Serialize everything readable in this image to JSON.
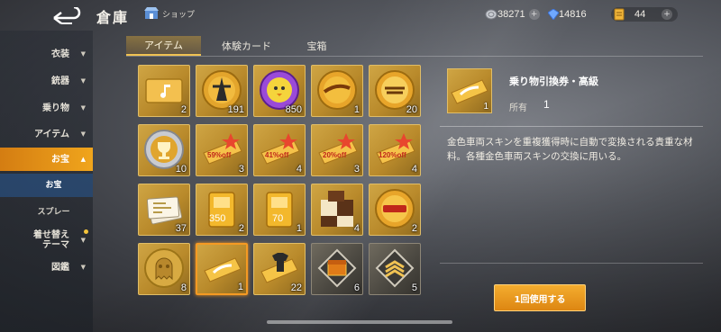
{
  "header": {
    "title": "倉庫",
    "shop_label": "ショップ",
    "currencies": [
      {
        "icon": "silver-coin-icon",
        "value": "38271"
      },
      {
        "icon": "blue-gem-icon",
        "value": "14816"
      },
      {
        "icon": "gold-ticket-icon",
        "value": "44"
      }
    ],
    "plus": "+"
  },
  "sidebar": {
    "items": [
      {
        "label": "衣装",
        "caret": "▼"
      },
      {
        "label": "銃器",
        "caret": "▼"
      },
      {
        "label": "乗り物",
        "caret": "▼"
      },
      {
        "label": "アイテム",
        "caret": "▼"
      },
      {
        "label": "お宝",
        "caret": "▲"
      },
      {
        "label": "お宝"
      },
      {
        "label": "スプレー"
      },
      {
        "label": "着せ替え\nテーマ",
        "caret": "▼"
      },
      {
        "label": "図鑑",
        "caret": "▼"
      }
    ]
  },
  "tabs": [
    {
      "label": "アイテム"
    },
    {
      "label": "体験カード"
    },
    {
      "label": "宝箱"
    }
  ],
  "items": [
    {
      "icon": "music-ticket-icon",
      "count": "2"
    },
    {
      "icon": "emblem-coin-icon",
      "count": "191"
    },
    {
      "icon": "chick-medal-icon",
      "count": "850"
    },
    {
      "icon": "event-coin-icon",
      "count": "1"
    },
    {
      "icon": "festival-coin-icon",
      "count": "20"
    },
    {
      "icon": "trophy-coin-icon",
      "count": "10"
    },
    {
      "icon": "discount-coupon-icon",
      "count": "3",
      "badge": "59%off"
    },
    {
      "icon": "discount-coupon-icon",
      "count": "4",
      "badge": "41%off"
    },
    {
      "icon": "discount-coupon-icon",
      "count": "3",
      "badge": "20%off"
    },
    {
      "icon": "discount-coupon-icon",
      "count": "4",
      "badge": "120%off"
    },
    {
      "icon": "ticket-stack-icon",
      "count": "37"
    },
    {
      "icon": "gold-card-icon",
      "count": "2",
      "badge": "350"
    },
    {
      "icon": "gold-card-icon",
      "count": "1",
      "badge": "70"
    },
    {
      "icon": "cookie-icon",
      "count": "4"
    },
    {
      "icon": "shop-coin-icon",
      "count": "2"
    },
    {
      "icon": "ghost-coin-icon",
      "count": "8"
    },
    {
      "icon": "vehicle-voucher-icon",
      "count": "1"
    },
    {
      "icon": "shirt-ticket-icon",
      "count": "22"
    },
    {
      "icon": "rank-chest-icon",
      "count": "6"
    },
    {
      "icon": "rank-badge-icon",
      "count": "5"
    }
  ],
  "detail": {
    "name": "乗り物引換券・高級",
    "owned_label": "所有",
    "owned_value": "1",
    "thumb_count": "1",
    "description": "金色車両スキンを重複獲得時に自動で変換される貴重な材料。各種金色車両スキンの交換に用いる。",
    "use_button": "1回使用する"
  }
}
